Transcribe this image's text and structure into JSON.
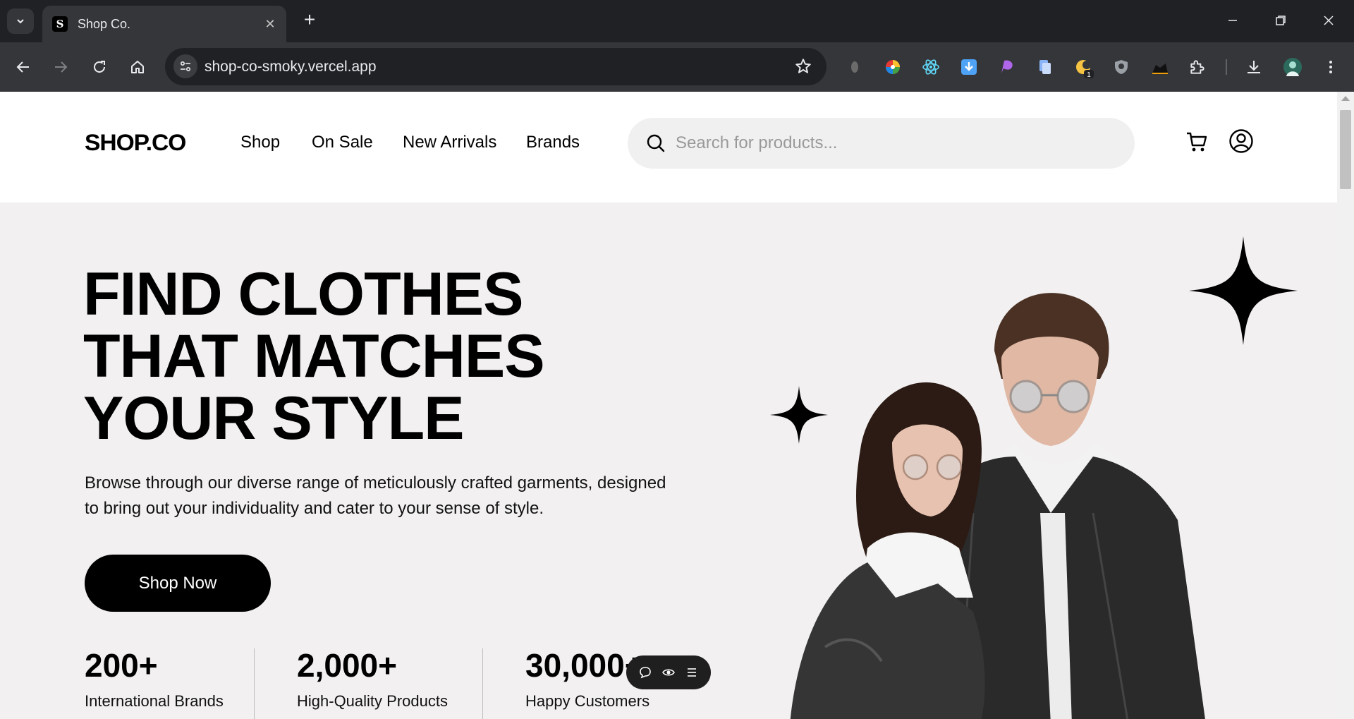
{
  "browser": {
    "tab_title": "Shop Co.",
    "tab_favicon": "S",
    "url": "shop-co-smoky.vercel.app",
    "extensions_badge": "1"
  },
  "site": {
    "logo": "SHOP.CO",
    "nav": [
      "Shop",
      "On Sale",
      "New Arrivals",
      "Brands"
    ],
    "search_placeholder": "Search for products..."
  },
  "hero": {
    "title_lines": [
      "FIND CLOTHES",
      "THAT MATCHES",
      "YOUR STYLE"
    ],
    "description": "Browse through our diverse range of meticulously crafted garments, designed to bring out your individuality and cater to your sense of style.",
    "cta": "Shop Now",
    "stats": [
      {
        "value": "200+",
        "label": "International Brands"
      },
      {
        "value": "2,000+",
        "label": "High-Quality Products"
      },
      {
        "value": "30,000+",
        "label": "Happy Customers"
      }
    ]
  },
  "colors": {
    "accent": "#000000",
    "hero_bg": "#F2F0F1",
    "search_bg": "#F0F0F0"
  }
}
